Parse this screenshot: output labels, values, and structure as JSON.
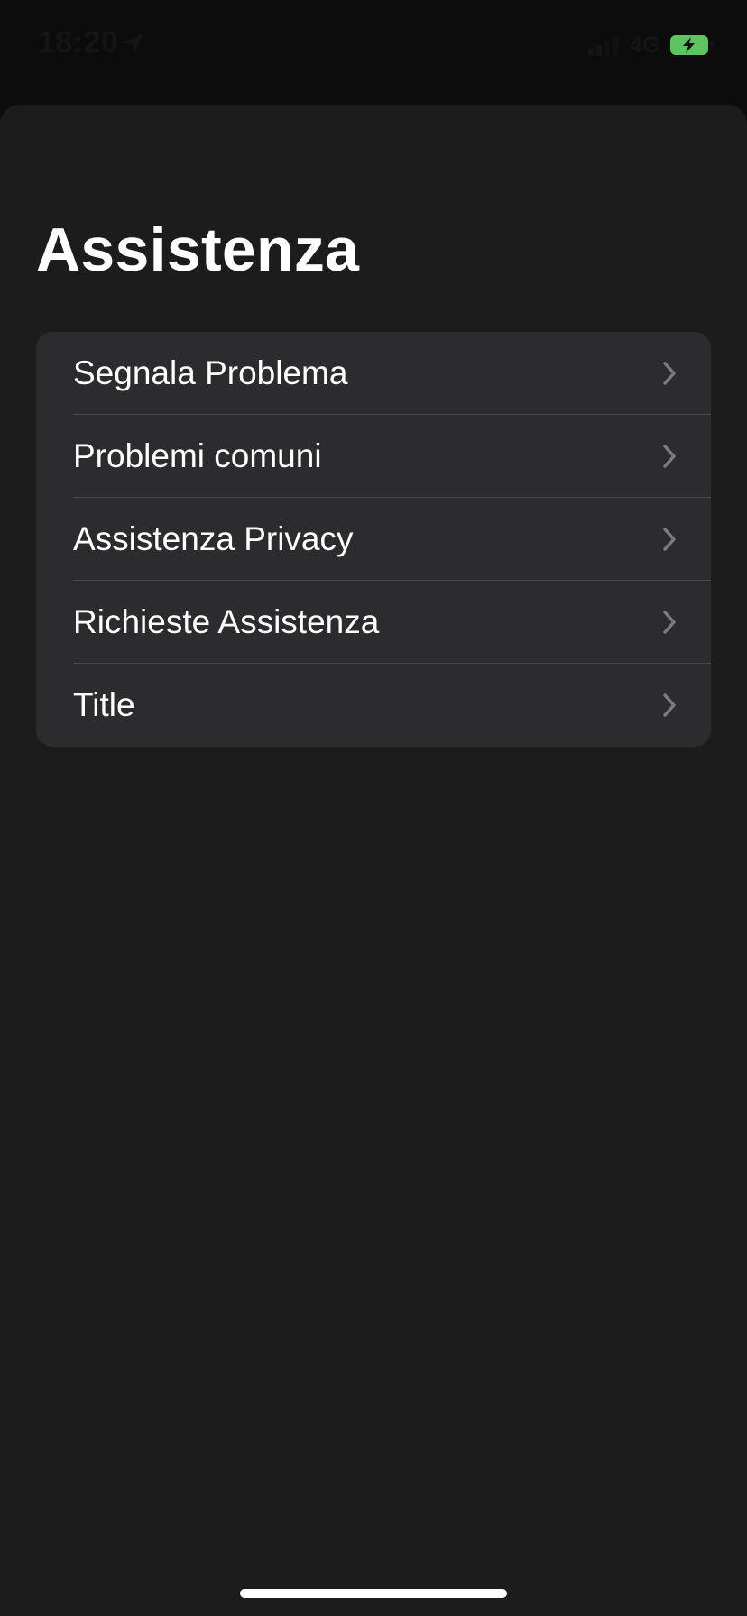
{
  "status_bar": {
    "time": "18:20",
    "network": "4G",
    "location_icon": "location-arrow-icon",
    "signal_icon": "cellular-signal-icon",
    "battery_icon": "battery-charging-icon",
    "battery_color": "#5fc35f"
  },
  "page": {
    "title": "Assistenza"
  },
  "menu": {
    "items": [
      {
        "label": "Segnala Problema",
        "icon": "chevron-right-icon"
      },
      {
        "label": "Problemi comuni",
        "icon": "chevron-right-icon"
      },
      {
        "label": "Assistenza Privacy",
        "icon": "chevron-right-icon"
      },
      {
        "label": "Richieste Assistenza",
        "icon": "chevron-right-icon"
      },
      {
        "label": "Title",
        "icon": "chevron-right-icon"
      }
    ]
  }
}
